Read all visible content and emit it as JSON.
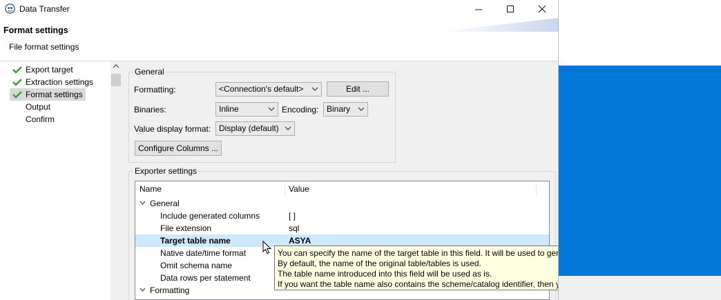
{
  "window": {
    "title": "Data Transfer",
    "controls": [
      "minimize",
      "maximize",
      "close"
    ]
  },
  "header": {
    "title": "Format settings",
    "subtitle": "File format settings"
  },
  "nav": {
    "items": [
      {
        "label": "Export target",
        "done": true
      },
      {
        "label": "Extraction settings",
        "done": true
      },
      {
        "label": "Format settings",
        "done": true,
        "selected": true
      },
      {
        "label": "Output",
        "done": false
      },
      {
        "label": "Confirm",
        "done": false
      }
    ]
  },
  "general": {
    "legend": "General",
    "formatting_label": "Formatting:",
    "formatting_value": "<Connection's default>",
    "edit_button": "Edit ...",
    "binaries_label": "Binaries:",
    "binaries_value": "Inline",
    "encoding_label": "Encoding:",
    "encoding_value": "Binary",
    "value_display_label": "Value display format:",
    "value_display_value": "Display (default)",
    "configure_button": "Configure Columns ..."
  },
  "exporter": {
    "legend": "Exporter settings",
    "columns": [
      "Name",
      "Value"
    ],
    "rows": [
      {
        "type": "group",
        "name": "General",
        "value": ""
      },
      {
        "type": "prop",
        "name": "Include generated columns",
        "value": "[ ]"
      },
      {
        "type": "prop",
        "name": "File extension",
        "value": "sql"
      },
      {
        "type": "prop",
        "name": "Target table name",
        "value": "ASYA",
        "selected": true
      },
      {
        "type": "prop",
        "name": "Native date/time format",
        "value": ""
      },
      {
        "type": "prop",
        "name": "Omit schema name",
        "value": ""
      },
      {
        "type": "prop",
        "name": "Data rows per statement",
        "value": ""
      },
      {
        "type": "group",
        "name": "Formatting",
        "value": ""
      }
    ]
  },
  "tooltip": {
    "lines": [
      "You can specify the name of the target table in this field. It will be used to generate an INSERT statement.",
      "By default, the name of the original table/tables is used.",
      "The table name introduced into this field will be used as is.",
      "If you want the table name also contains the scheme/catalog identifier, then you can prescribe it in this field by yourself."
    ]
  },
  "colors": {
    "desktop_accent": "#0078d7",
    "check_green": "#3a9a3a",
    "selection": "#cce8ff",
    "tooltip_bg": "#ffffe1"
  }
}
